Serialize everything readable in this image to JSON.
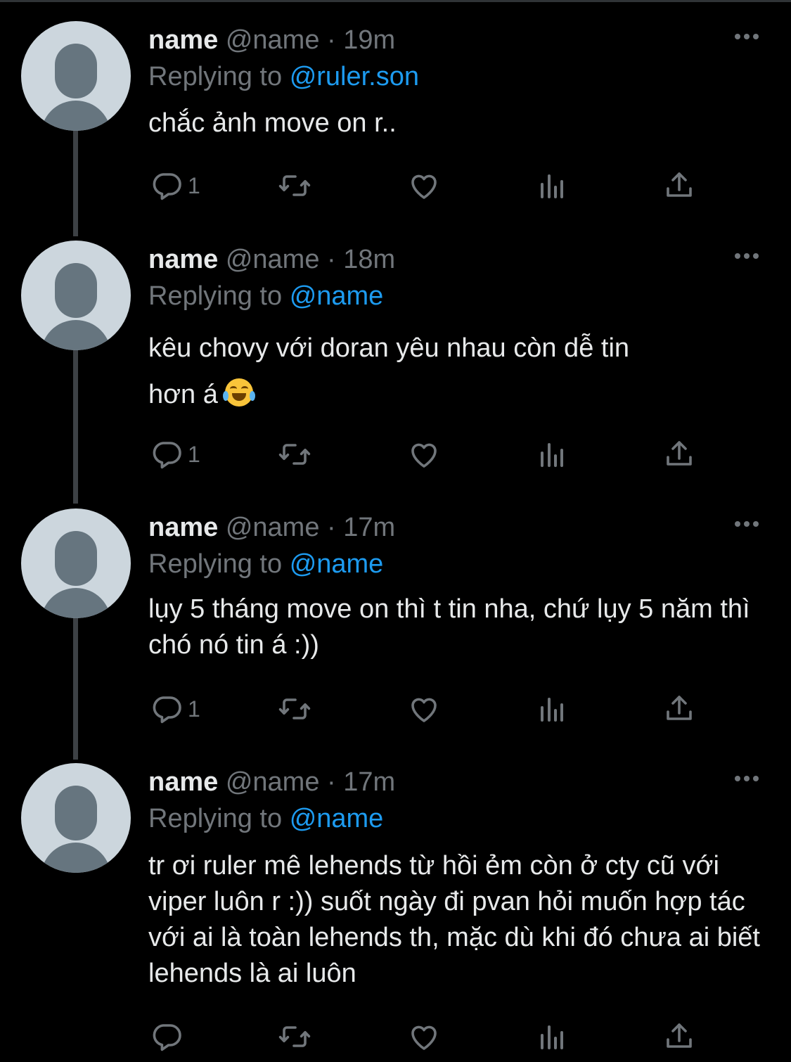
{
  "tweets": [
    {
      "name": "name",
      "handle": "@name",
      "dot": "·",
      "time": "19m",
      "replying_prefix": "Replying to",
      "replying_to": "@ruler.son",
      "text": "chắc ảnh move on r..",
      "reply_count": "1"
    },
    {
      "name": "name",
      "handle": "@name",
      "dot": "·",
      "time": "18m",
      "replying_prefix": "Replying to",
      "replying_to": "@name",
      "text_line1": "kêu chovy với doran yêu nhau còn dễ tin",
      "text_line2": "hơn á",
      "emoji": "face-with-tears-of-joy",
      "reply_count": "1"
    },
    {
      "name": "name",
      "handle": "@name",
      "dot": "·",
      "time": "17m",
      "replying_prefix": "Replying to",
      "replying_to": "@name",
      "text": "lụy 5 tháng move on thì t tin nha, chứ lụy 5 năm thì chó nó tin á :))",
      "reply_count": "1"
    },
    {
      "name": "name",
      "handle": "@name",
      "dot": "·",
      "time": "17m",
      "replying_prefix": "Replying to",
      "replying_to": "@name",
      "text": "tr ơi ruler mê lehends từ hồi ẻm còn ở cty cũ với viper luôn r :)) suốt ngày đi pvan hỏi muốn hợp tác với ai là toàn lehends th, mặc dù khi đó chưa ai biết lehends là ai luôn",
      "reply_count": ""
    }
  ],
  "icons": [
    "reply-icon",
    "retweet-icon",
    "like-icon",
    "views-icon",
    "share-icon",
    "more-icon"
  ],
  "colors": {
    "background": "#000000",
    "text": "#e7e9ea",
    "secondary": "#71767b",
    "mention": "#1d9bf0",
    "avatar_bg": "#ccd6dd",
    "avatar_fg": "#66757f",
    "thread_line": "#3d4145"
  }
}
